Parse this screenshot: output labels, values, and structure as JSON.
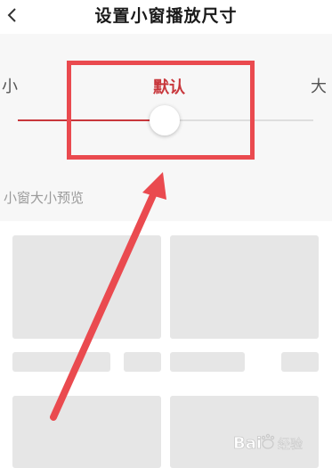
{
  "header": {
    "title": "设置小窗播放尺寸",
    "back_icon": "chevron-left-icon"
  },
  "slider": {
    "min_label": "小",
    "max_label": "大",
    "current_label": "默认",
    "value_fraction": 0.45,
    "accent_color": "#c8373c"
  },
  "preview": {
    "label": "小窗大小预览"
  },
  "annotation": {
    "color": "#ea4a4f"
  },
  "watermark": {
    "text": "Baidu经验"
  }
}
